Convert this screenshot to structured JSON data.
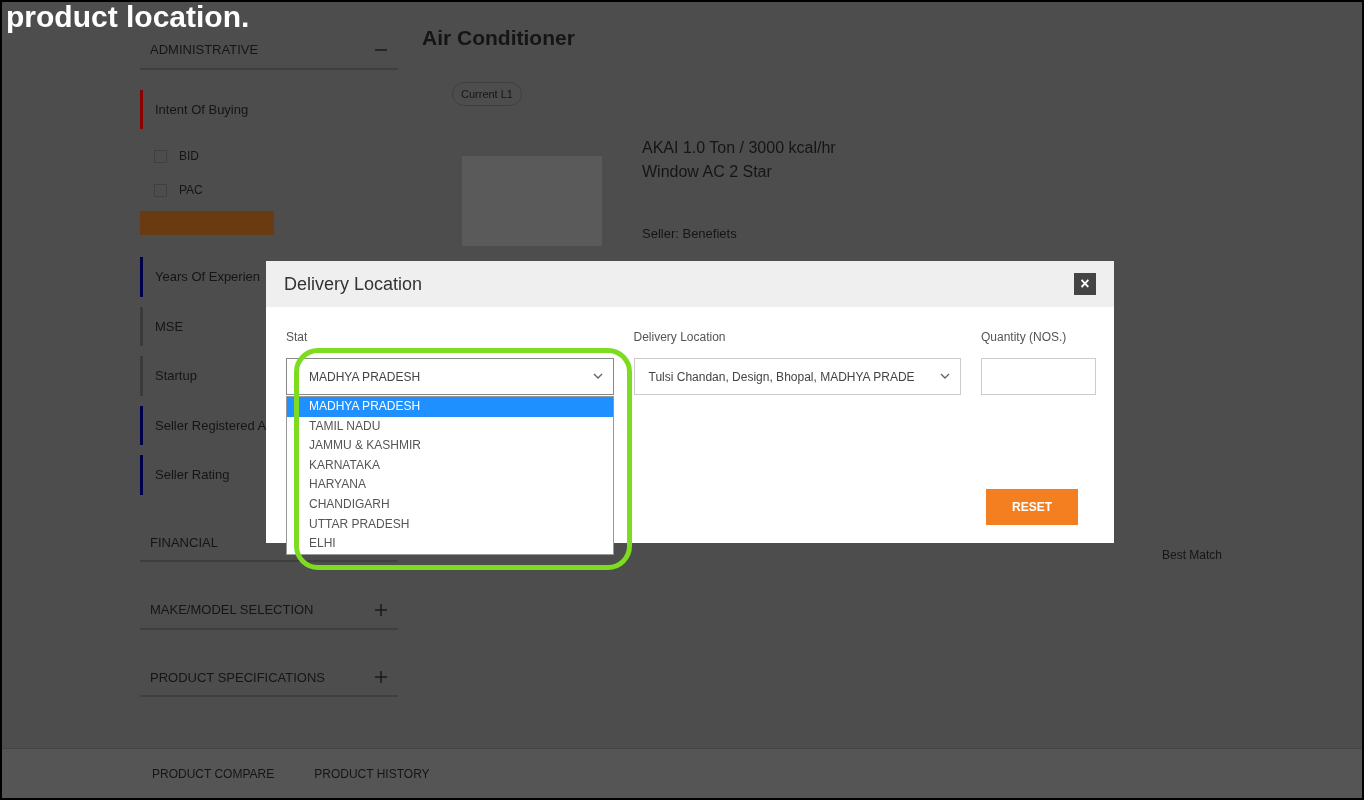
{
  "caption": "product location.",
  "sidebar": {
    "top_section": {
      "title": "ADMINISTRATIVE",
      "expanded": true
    },
    "filters": [
      {
        "kind": "group",
        "label": "Intent Of Buying",
        "color": "#8b0000",
        "options": [
          {
            "label": "BID",
            "checked": false
          },
          {
            "label": "PAC",
            "checked": false
          }
        ]
      },
      {
        "kind": "button"
      },
      {
        "kind": "group",
        "label": "Years Of Experien",
        "color": "#00004d"
      },
      {
        "kind": "group",
        "label": "MSE",
        "color": "#3a3a3a"
      },
      {
        "kind": "group",
        "label": "Startup",
        "color": "#3a3a3a"
      },
      {
        "kind": "group",
        "label": "Seller Registered A",
        "color": "#00004d"
      },
      {
        "kind": "group",
        "label": "Seller Rating",
        "color": "#00004d"
      }
    ],
    "sections": [
      {
        "title": "FINANCIAL"
      },
      {
        "title": "MAKE/MODEL SELECTION",
        "expanded": false
      },
      {
        "title": "PRODUCT SPECIFICATIONS",
        "expanded": false
      }
    ]
  },
  "main": {
    "title": "Air Conditioner",
    "tag": "Current L1",
    "product": {
      "name": "AKAI 1.0 Ton / 3000 kcal/hr Window AC 2 Star",
      "seller": "Seller: Benefiets"
    },
    "sort": "Best Match"
  },
  "modal": {
    "title": "Delivery Location",
    "close": "×",
    "state": {
      "label": "Stat",
      "value": "MADHYA PRADESH",
      "expanded": true,
      "options": [
        {
          "label": "MADHYA PRADESH",
          "selected": true
        },
        {
          "label": "TAMIL NADU",
          "selected": false
        },
        {
          "label": "JAMMU & KASHMIR",
          "selected": false
        },
        {
          "label": "KARNATAKA",
          "selected": false
        },
        {
          "label": "HARYANA",
          "selected": false
        },
        {
          "label": "CHANDIGARH",
          "selected": false
        },
        {
          "label": "UTTAR PRADESH",
          "selected": false
        },
        {
          "label": "ELHI",
          "selected": false
        }
      ]
    },
    "location": {
      "label": "Delivery Location",
      "value": "Tulsi Chandan, Design, Bhopal, MADHYA PRADE"
    },
    "quantity": {
      "label": "Quantity (NOS.)"
    },
    "reset": "RESET"
  },
  "bottom_bar": {
    "items": [
      "PRODUCT COMPARE",
      "PRODUCT HISTORY"
    ]
  }
}
